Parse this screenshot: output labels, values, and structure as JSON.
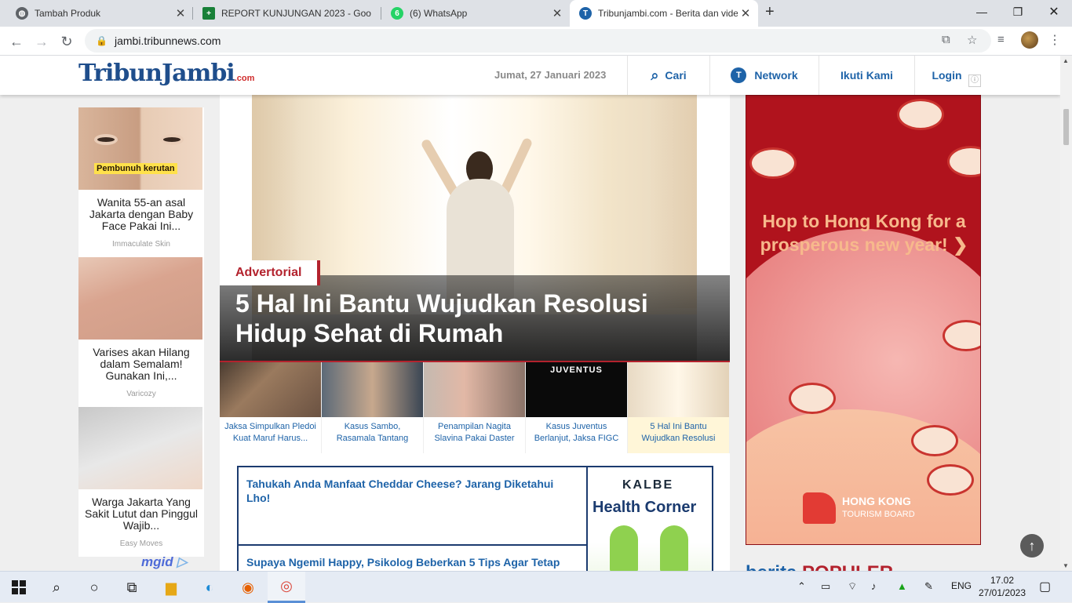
{
  "browser": {
    "tabs": [
      {
        "title": "Tambah Produk",
        "icon": "globe-icon",
        "color": "#5f6368"
      },
      {
        "title": "REPORT KUNJUNGAN 2023 - Goo",
        "icon": "sheets-icon",
        "color": "#188038"
      },
      {
        "title": "(6) WhatsApp",
        "icon": "whatsapp-icon",
        "color": "#25d366"
      },
      {
        "title": "Tribunjambi.com - Berita dan vide",
        "icon": "tribun-icon",
        "color": "#1e63a8"
      }
    ],
    "new_tab": "+",
    "url": "jambi.tribunnews.com"
  },
  "site": {
    "logo": "TribunJambi",
    "logo_suffix": ".com",
    "date": "Jumat, 27 Januari 2023",
    "nav": {
      "search": "Cari",
      "network": "Network",
      "follow": "Ikuti Kami",
      "login": "Login"
    }
  },
  "left_ads": [
    {
      "caption": "Wanita 55-an asal Jakarta dengan Baby Face Pakai Ini...",
      "source": "Immaculate Skin",
      "overlay": "Pembunuh kerutan"
    },
    {
      "caption": "Varises akan Hilang dalam Semalam! Gunakan Ini,...",
      "source": "Varicozy"
    },
    {
      "caption": "Warga Jakarta Yang Sakit Lutut dan Pinggul Wajib...",
      "source": "Easy Moves"
    }
  ],
  "mgid": {
    "brand": "mgid",
    "mark": "▷"
  },
  "hero": {
    "badge": "Advertorial",
    "title": "5 Hal Ini Bantu Wujudkan Resolusi Hidup Sehat di Rumah"
  },
  "thumbs": [
    {
      "title": "Jaksa Simpulkan Pledoi Kuat Maruf Harus..."
    },
    {
      "title": "Kasus Sambo, Rasamala Tantang"
    },
    {
      "title": "Penampilan Nagita Slavina Pakai Daster"
    },
    {
      "title": "Kasus Juventus Berlanjut, Jaksa FIGC",
      "logo_text": "JUVENTUS"
    },
    {
      "title": "5 Hal Ini Bantu Wujudkan Resolusi"
    }
  ],
  "related": [
    {
      "title": "Tahukah Anda Manfaat Cheddar Cheese? Jarang Diketahui Lho!"
    },
    {
      "title": "Supaya Ngemil Happy, Psikolog Beberkan 5 Tips Agar Tetap"
    }
  ],
  "related_ad": {
    "brand": "KALBE",
    "title": "Health Corner"
  },
  "right_ad": {
    "headline": "Hop to Hong Kong for a prosperous new year! ❯",
    "logo_line1": "HONG KONG",
    "logo_line2": "TOURISM BOARD"
  },
  "populer": {
    "prefix": "berita ",
    "word": "POPULER"
  },
  "taskbar": {
    "lang": "ENG",
    "time": "17.02",
    "date": "27/01/2023"
  }
}
